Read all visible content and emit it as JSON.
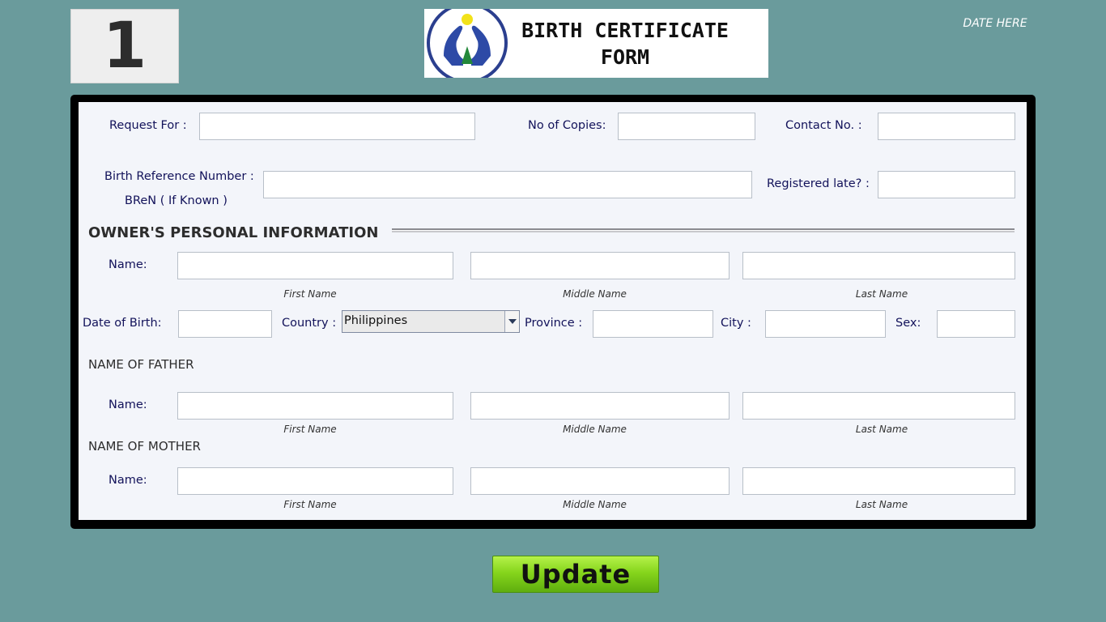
{
  "header": {
    "form_number": "1",
    "title_line1": "BIRTH CERTIFICATE",
    "title_line2": "FORM",
    "date": "DATE HERE",
    "logo_icon": "hands-family-logo-icon"
  },
  "request": {
    "request_for_label": "Request For :",
    "copies_label": "No of Copies:",
    "contact_label": "Contact No. :",
    "bref_label": "Birth Reference Number :",
    "bren_label": "BReN ( If Known )",
    "late_label": "Registered late? :"
  },
  "owner": {
    "section_title": "OWNER'S PERSONAL INFORMATION",
    "name_label": "Name:",
    "first_caption": "First Name",
    "middle_caption": "Middle Name",
    "last_caption": "Last Name",
    "dob_label": "Date of Birth:",
    "country_label": "Country :",
    "country_value": "Philippines",
    "province_label": "Province :",
    "city_label": "City :",
    "sex_label": "Sex:"
  },
  "father": {
    "section_title": "NAME OF FATHER",
    "name_label": "Name:",
    "first_caption": "First Name",
    "middle_caption": "Middle Name",
    "last_caption": "Last Name"
  },
  "mother": {
    "section_title": "NAME OF MOTHER",
    "name_label": "Name:",
    "first_caption": "First Name",
    "middle_caption": "Middle Name",
    "last_caption": "Last Name"
  },
  "actions": {
    "update_label": "Update"
  },
  "colors": {
    "background": "#6a9b9c",
    "panel": "#f3f5fa",
    "label": "#12125a",
    "button_green": "#86d51c"
  }
}
